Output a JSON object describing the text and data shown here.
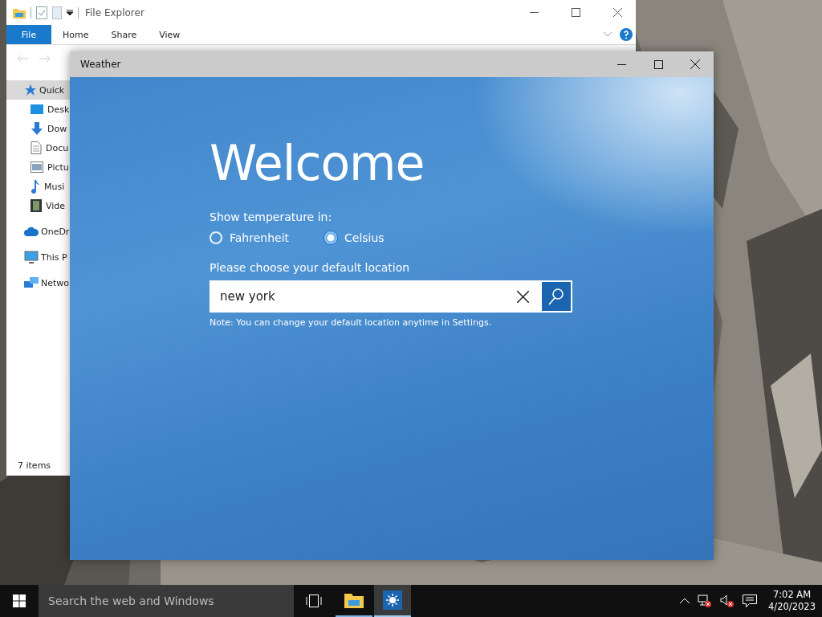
{
  "explorer": {
    "title": "File Explorer",
    "ribbon_tabs": [
      {
        "label": "File",
        "kind": "file"
      },
      {
        "label": "Home",
        "kind": "tab"
      },
      {
        "label": "Share",
        "kind": "tab"
      },
      {
        "label": "View",
        "kind": "tab"
      }
    ],
    "nav_items": [
      {
        "label": "Quick",
        "kind": "star",
        "selected": true,
        "children": [
          {
            "label": "Desk",
            "kind": "desktop",
            "selected": false
          },
          {
            "label": "Dow",
            "kind": "download",
            "selected": false
          },
          {
            "label": "Docu",
            "kind": "document",
            "selected": false
          },
          {
            "label": "Pictu",
            "kind": "picture",
            "selected": false
          },
          {
            "label": "Musi",
            "kind": "music",
            "selected": false
          },
          {
            "label": "Vide",
            "kind": "video",
            "selected": false
          }
        ]
      },
      {
        "label": "OneDr",
        "kind": "cloud",
        "selected": false
      },
      {
        "label": "This P",
        "kind": "pc",
        "selected": false
      },
      {
        "label": "Netwo",
        "kind": "network",
        "selected": false
      }
    ],
    "status": "7 items"
  },
  "weather": {
    "title": "Weather",
    "heading": "Welcome",
    "unit_label": "Show temperature in:",
    "units": [
      {
        "label": "Fahrenheit",
        "selected": false
      },
      {
        "label": "Celsius",
        "selected": true
      }
    ],
    "location_label": "Please choose your default location",
    "search": {
      "value": "new york"
    },
    "note": "Note: You can change your default location anytime in Settings."
  },
  "taskbar": {
    "search": {
      "placeholder": "Search the web and Windows"
    },
    "apps": [
      {
        "kind": "folder",
        "selected": false
      },
      {
        "kind": "weather",
        "selected": true
      }
    ],
    "time": "7:02 AM",
    "date": "4/20/2023"
  }
}
